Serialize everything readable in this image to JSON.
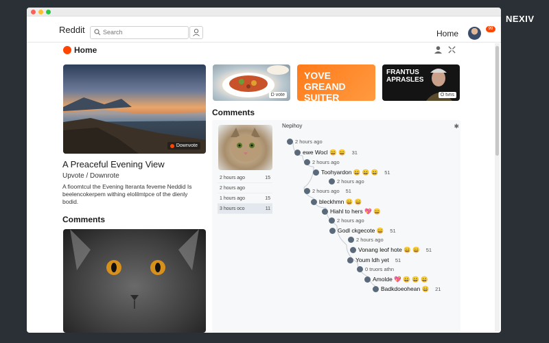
{
  "window": {
    "dots": [
      "#ff5f57",
      "#febc2e",
      "#28c840"
    ]
  },
  "brand_overlay": "NEXIV",
  "topnav": {
    "logo": "Reddit",
    "search_placeholder": "Search",
    "home_label": "Home",
    "notif_count": "99"
  },
  "page": {
    "home_label": "Home"
  },
  "featured_post": {
    "badge": "Downvote",
    "title": "A Preaceful Evening View",
    "vote_text": "Upvote  /  Downrote",
    "body": "A fioomtcul the Evening Iteranta feveme Neddid Is beelencokerpem withing elolilmtpce of the dienly bodid."
  },
  "top_cards": [
    {
      "type": "food",
      "badge": "D vote"
    },
    {
      "type": "promo",
      "text": "YOVE GREAND SUITER"
    },
    {
      "type": "portrait",
      "text": "FRANTUS APRASLES",
      "badge": "O tvns"
    }
  ],
  "left_comments": {
    "heading": "Comments"
  },
  "right_comments": {
    "heading": "Comments",
    "mini_list": [
      {
        "time": "2 hours ago",
        "count": "15"
      },
      {
        "time": "2 hours ago",
        "count": ""
      },
      {
        "time": "1 hours ago",
        "count": "15"
      },
      {
        "time": "3 hours oco",
        "count": "11"
      }
    ],
    "thread_header": "Nepihoy",
    "lines": [
      {
        "kind": "meta",
        "text": "2 hours ago"
      },
      {
        "kind": "msg",
        "text": "ewe Wocl 😄 😄",
        "pts": "31"
      },
      {
        "kind": "meta",
        "text": "2 hours ago"
      },
      {
        "kind": "msg",
        "text": "Toohyardon 😄 😄 😄",
        "pts": "51"
      },
      {
        "kind": "meta",
        "text": "2 hours ago"
      },
      {
        "kind": "meta",
        "text": "2 hours ago",
        "pts": "51"
      },
      {
        "kind": "msg",
        "text": "bleckhmn 😄 😄"
      },
      {
        "kind": "msg",
        "text": "Hiahl to hers 💖 😄"
      },
      {
        "kind": "meta",
        "text": "2 hours ago"
      },
      {
        "kind": "msg",
        "text": "Godl ckgecote 😄",
        "pts": "51"
      },
      {
        "kind": "meta",
        "text": "2 hours ago"
      },
      {
        "kind": "msg",
        "text": "Vonang leof hote 😄 😄",
        "pts": "51"
      },
      {
        "kind": "msg",
        "text": "Youm ldh yet",
        "pts": "51"
      },
      {
        "kind": "meta",
        "text": "0 truors athn"
      },
      {
        "kind": "msg",
        "text": "Amolde 💖 😄 😄 😄"
      },
      {
        "kind": "msg",
        "text": "Badkdoeohean 😄",
        "pts": "21"
      }
    ]
  }
}
